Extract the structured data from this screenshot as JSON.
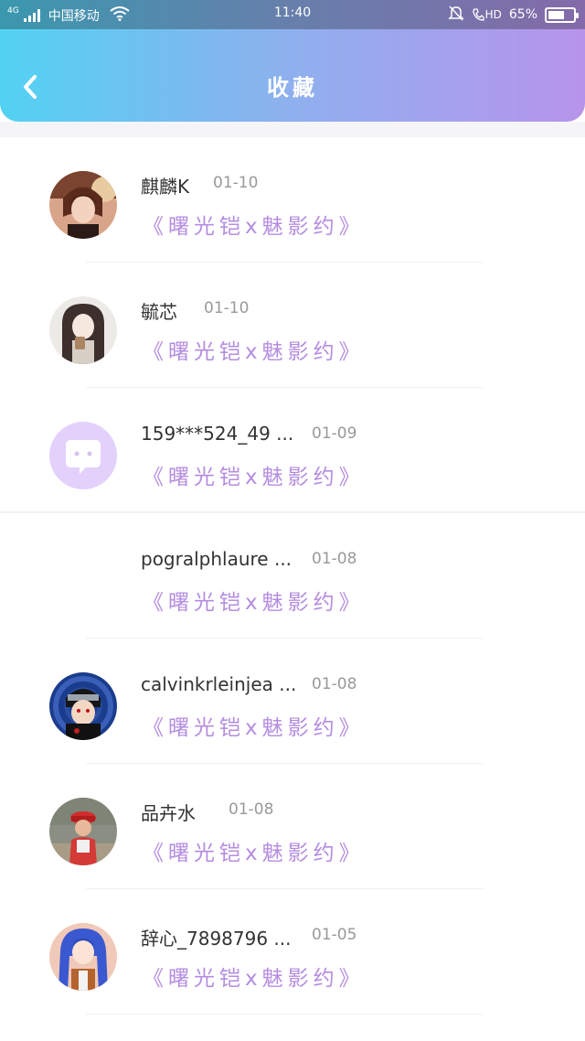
{
  "status_bar": {
    "network": "4G",
    "carrier": "中国移动",
    "time": "11:40",
    "hd": "HD",
    "battery": "65%",
    "battery_level": 0.65
  },
  "header": {
    "title": "收藏",
    "back_icon": "chevron-left-icon",
    "gradient_colors": [
      "#52d2f2",
      "#b794ea"
    ]
  },
  "favorites": [
    {
      "username": "麒麟K",
      "date": "01-10",
      "title": "《曙光铠x魅影约》",
      "avatar": "anime-avatar-brown-hair"
    },
    {
      "username": "毓芯",
      "date": "01-10",
      "title": "《曙光铠x魅影约》",
      "avatar": "anime-avatar-girl-with-cup"
    },
    {
      "username": "159***524_49 ...",
      "date": "01-09",
      "title": "《曙光铠x魅影约》",
      "avatar": "default-chat-avatar"
    },
    {
      "username": "pogralphlaure ...",
      "date": "01-08",
      "title": "《曙光铠x魅影约》",
      "avatar": "none"
    },
    {
      "username": "calvinkrleinjea ...",
      "date": "01-08",
      "title": "《曙光铠x魅影约》",
      "avatar": "anime-avatar-ninja"
    },
    {
      "username": "品卉水",
      "date": "01-08",
      "title": "《曙光铠x魅影约》",
      "avatar": "photo-avatar-red-cap"
    },
    {
      "username": "辞心_7898796 ...",
      "date": "01-05",
      "title": "《曙光铠x魅影约》",
      "avatar": "anime-avatar-blue-hair"
    }
  ],
  "colors": {
    "accent_purple": "#b58de0",
    "username_text": "#333333",
    "date_text": "#999999"
  }
}
